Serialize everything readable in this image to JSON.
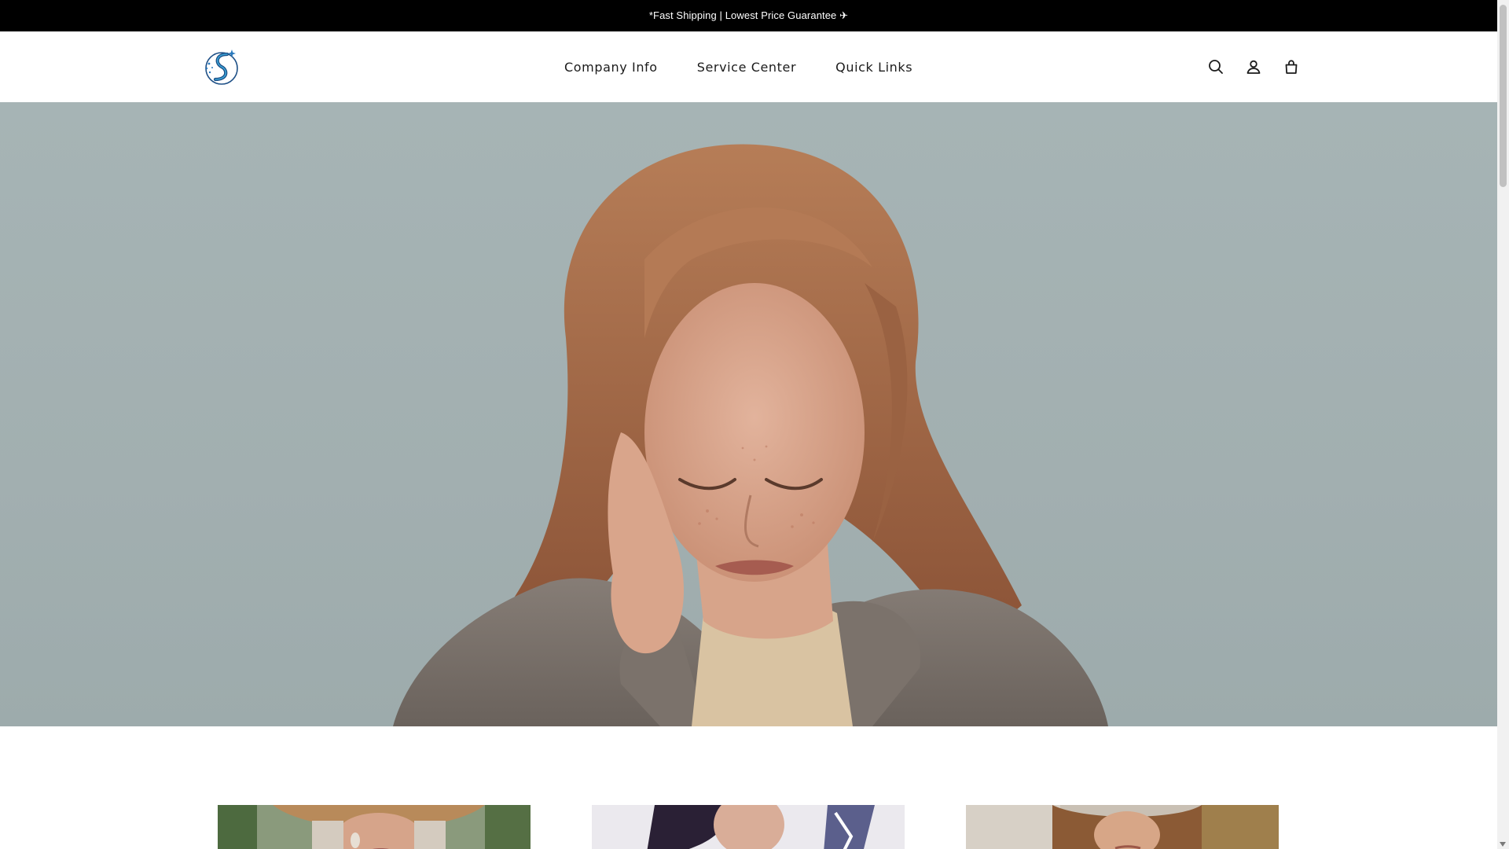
{
  "announcement": {
    "text": "*Fast Shipping | Lowest Price Guarantee ✈"
  },
  "header": {
    "logo_icon": "dna-s-logo",
    "nav": [
      {
        "label": "Company Info"
      },
      {
        "label": "Service Center"
      },
      {
        "label": "Quick Links"
      }
    ],
    "icons": [
      "search-icon",
      "account-icon",
      "cart-icon"
    ]
  },
  "hero": {
    "image": "woman-in-gray-coat-photo"
  },
  "collections": [
    {
      "image": "woman-in-straw-hat-photo"
    },
    {
      "image": "woman-with-dark-hair-photo"
    },
    {
      "image": "woman-in-fur-hood-photo"
    }
  ],
  "colors": {
    "announcement_bg": "#000000",
    "text": "#1b1b1b",
    "hero_bg": "#a4b2b3"
  }
}
